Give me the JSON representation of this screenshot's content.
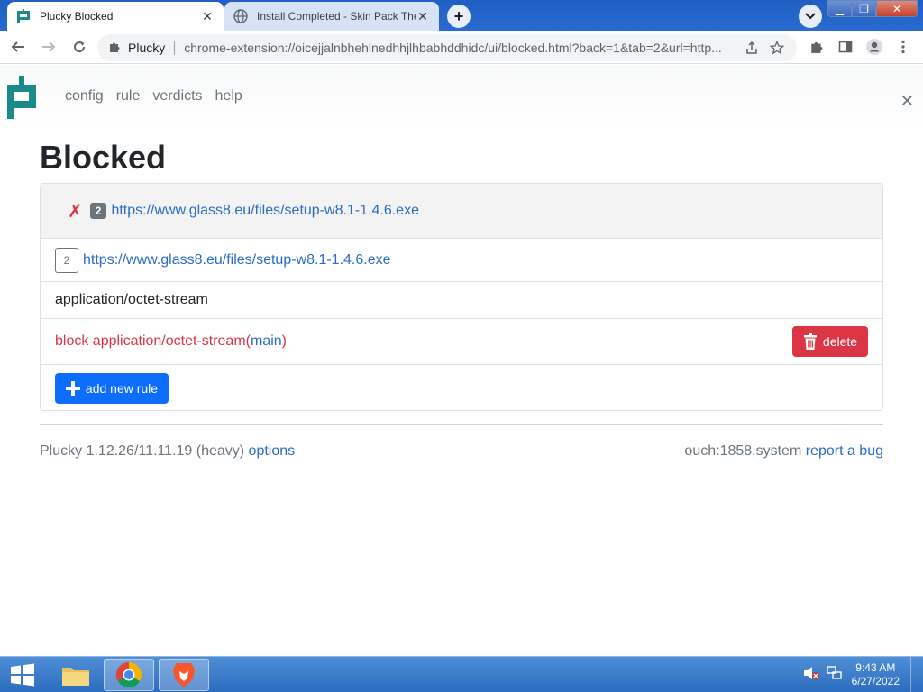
{
  "browser": {
    "tabs": [
      {
        "title": "Plucky Blocked",
        "favicon": "plucky-icon",
        "active": true
      },
      {
        "title": "Install Completed - Skin Pack The",
        "favicon": "globe-icon",
        "active": false
      }
    ],
    "omnibox": {
      "extension_label": "Plucky",
      "url": "chrome-extension://oicejjalnbhehlnedhhjlhbabhddhidc/ui/blocked.html?back=1&tab=2&url=http..."
    }
  },
  "nav": {
    "items": [
      "config",
      "rule",
      "verdicts",
      "help"
    ]
  },
  "page": {
    "title": "Blocked"
  },
  "blocked": {
    "header_mark": "✗",
    "header_badge": "2",
    "header_url": "https://www.glass8.eu/files/setup-w8.1-1.4.6.exe",
    "request_badge": "2",
    "request_url": "https://www.glass8.eu/files/setup-w8.1-1.4.6.exe",
    "mime_type": "application/octet-stream",
    "rule_text": "block application/octet-stream",
    "rule_open_paren": " (",
    "rule_scope": "main",
    "rule_close_paren": ")",
    "delete_label": "delete",
    "add_rule_label": "add new rule"
  },
  "footer": {
    "version": "Plucky 1.12.26/11.11.19 (heavy) ",
    "options_label": "options",
    "sys_info": "ouch:1858,system ",
    "report_label": "report a bug"
  },
  "taskbar": {
    "time": "9:43 AM",
    "date": "6/27/2022"
  },
  "colors": {
    "link": "#2b6cc4",
    "danger": "#dc3545",
    "primary": "#0d6efd",
    "logo_teal": "#1a8a8a"
  }
}
